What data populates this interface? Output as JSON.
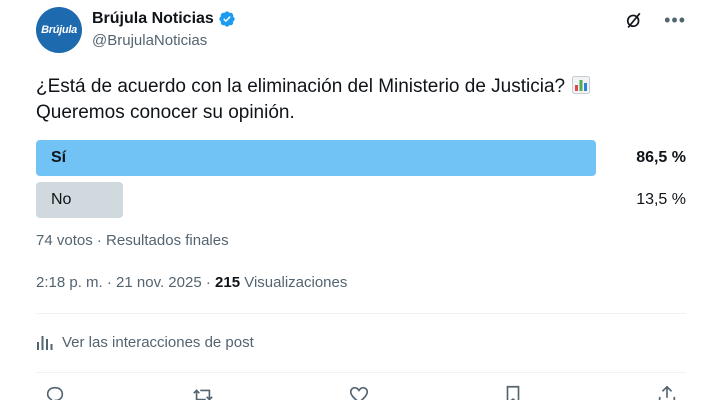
{
  "author": {
    "avatar_text": "Brújula",
    "display_name": "Brújula Noticias",
    "handle": "@BrujulaNoticias",
    "verified": true
  },
  "post": {
    "text": "¿Está de acuerdo con la eliminación del Ministerio de Justicia?",
    "text_line2": "Queremos conocer su opinión.",
    "emoji": "bar-chart-emoji"
  },
  "poll": {
    "options": [
      {
        "label": "Sí",
        "percent_text": "86,5 %",
        "percent": 86.5,
        "winner": true
      },
      {
        "label": "No",
        "percent_text": "13,5 %",
        "percent": 13.5,
        "winner": false
      }
    ],
    "meta": "74 votos · Resultados finales"
  },
  "timestamp": {
    "time": "2:18 p. m.",
    "date": "21 nov. 2025",
    "views_count": "215",
    "views_label": "Visualizaciones"
  },
  "interactions_link": "Ver las interacciones de post",
  "icons": {
    "verified": "verified-badge-icon",
    "grok": "grok-icon",
    "more": "more-icon",
    "analytics": "analytics-icon",
    "reply": "reply-icon",
    "repost": "repost-icon",
    "like": "like-icon",
    "bookmark": "bookmark-icon",
    "share": "share-icon"
  },
  "colors": {
    "accent": "#1d9bf0",
    "poll_winner": "#72c3f5",
    "poll_other": "#cfd9de",
    "secondary_text": "#536471",
    "avatar_bg": "#1d6aae"
  }
}
